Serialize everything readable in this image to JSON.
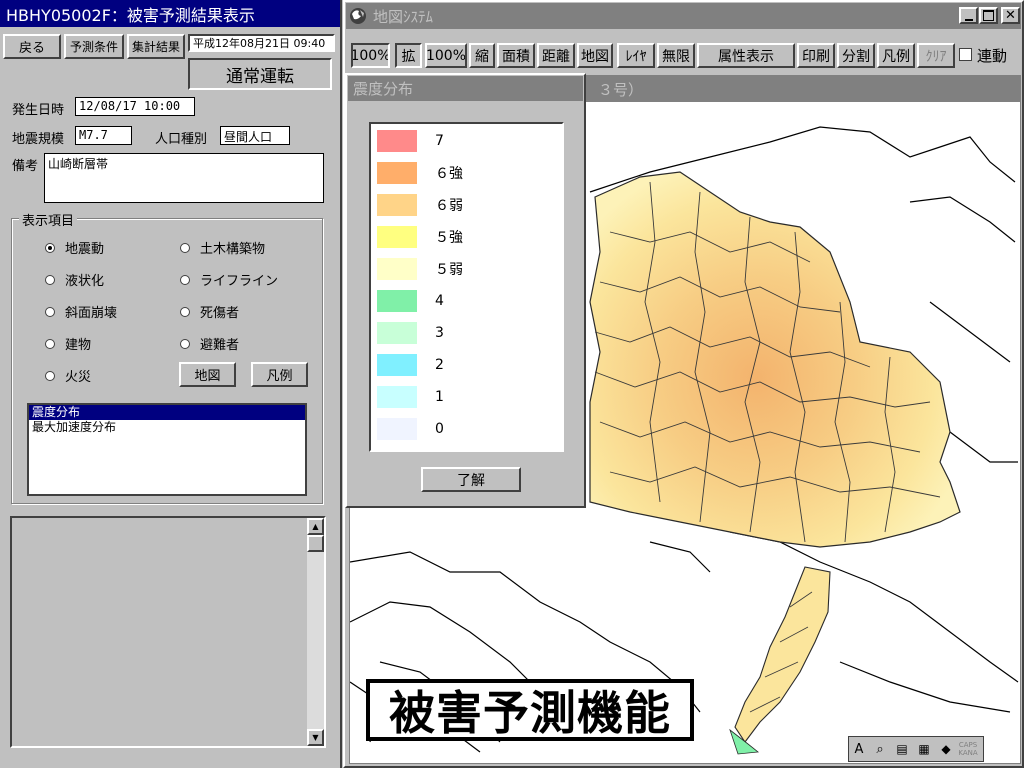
{
  "left_window": {
    "title": "HBHY05002F：被害予測結果表示",
    "buttons": {
      "back": "戻る",
      "prediction_conditions": "予測条件",
      "summary_results": "集計結果"
    },
    "datetime_display": "平成12年08月21日 09:40",
    "mode_label": "通常運転",
    "fields": {
      "occurrence_label": "発生日時",
      "occurrence_value": "12/08/17 10:00",
      "magnitude_label": "地震規模",
      "magnitude_value": "M7.7",
      "population_label": "人口種別",
      "population_value": "昼間人口",
      "remarks_label": "備考",
      "remarks_value": "山崎断層帯"
    },
    "display_items": {
      "title": "表示項目",
      "options": [
        {
          "label": "地震動",
          "selected": true
        },
        {
          "label": "土木構築物",
          "selected": false
        },
        {
          "label": "液状化",
          "selected": false
        },
        {
          "label": "ライフライン",
          "selected": false
        },
        {
          "label": "斜面崩壊",
          "selected": false
        },
        {
          "label": "死傷者",
          "selected": false
        },
        {
          "label": "建物",
          "selected": false
        },
        {
          "label": "避難者",
          "selected": false
        },
        {
          "label": "火災",
          "selected": false
        }
      ],
      "map_button": "地図",
      "legend_button": "凡例",
      "list": [
        "震度分布",
        "最大加速度分布"
      ]
    }
  },
  "map_window": {
    "title": "地図ｼｽﾃﾑ",
    "toolbar": [
      "100%",
      "拡",
      "100%",
      "縮",
      "面積",
      "距離",
      "地図",
      "ﾚｲﾔ",
      "無限",
      "属性表示",
      "印刷",
      "分割",
      "凡例",
      "ｸﾘｱ"
    ],
    "link_label": "連動",
    "map_header_fragment": "３号）",
    "banner_text": "被害予測機能"
  },
  "legend_dialog": {
    "title": "震度分布",
    "items": [
      {
        "label": "7",
        "color": "#ff8a8a"
      },
      {
        "label": "６強",
        "color": "#ffae6a"
      },
      {
        "label": "６弱",
        "color": "#ffd488"
      },
      {
        "label": "５強",
        "color": "#ffff80"
      },
      {
        "label": "５弱",
        "color": "#ffffc8"
      },
      {
        "label": "4",
        "color": "#80f0a8"
      },
      {
        "label": "3",
        "color": "#c8ffd8"
      },
      {
        "label": "2",
        "color": "#80f0ff"
      },
      {
        "label": "1",
        "color": "#c8ffff"
      },
      {
        "label": "0",
        "color": "#f0f4ff"
      }
    ],
    "ok_button": "了解"
  },
  "ime_bar": {
    "icons": [
      "A",
      "magnifier-icon",
      "book-icon",
      "table-icon",
      "eraser-icon",
      "caps-kana-icon"
    ]
  }
}
